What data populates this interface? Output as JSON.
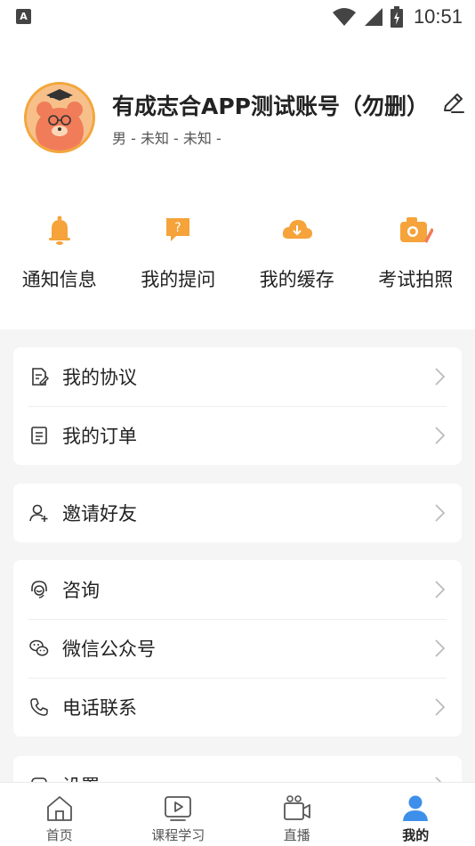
{
  "status_bar": {
    "time": "10:51",
    "notification_icon": "a-icon"
  },
  "profile": {
    "username": "有成志合APP测试账号（勿删）",
    "subinfo": "男 - 未知 - 未知 -"
  },
  "quick_actions": [
    {
      "label": "通知信息",
      "icon": "bell-icon"
    },
    {
      "label": "我的提问",
      "icon": "question-icon"
    },
    {
      "label": "我的缓存",
      "icon": "cloud-download-icon"
    },
    {
      "label": "考试拍照",
      "icon": "camera-icon"
    }
  ],
  "menu": {
    "agreement": "我的协议",
    "orders": "我的订单",
    "invite": "邀请好友",
    "consult": "咨询",
    "wechat": "微信公众号",
    "phone": "电话联系",
    "settings": "设置"
  },
  "tabs": [
    {
      "label": "首页",
      "icon": "home-icon"
    },
    {
      "label": "课程学习",
      "icon": "play-icon"
    },
    {
      "label": "直播",
      "icon": "video-camera-icon"
    },
    {
      "label": "我的",
      "icon": "user-icon",
      "active": true
    }
  ],
  "colors": {
    "accent_orange": "#f5a33a",
    "active_blue": "#3d8fea",
    "background": "#f5f5f5"
  }
}
